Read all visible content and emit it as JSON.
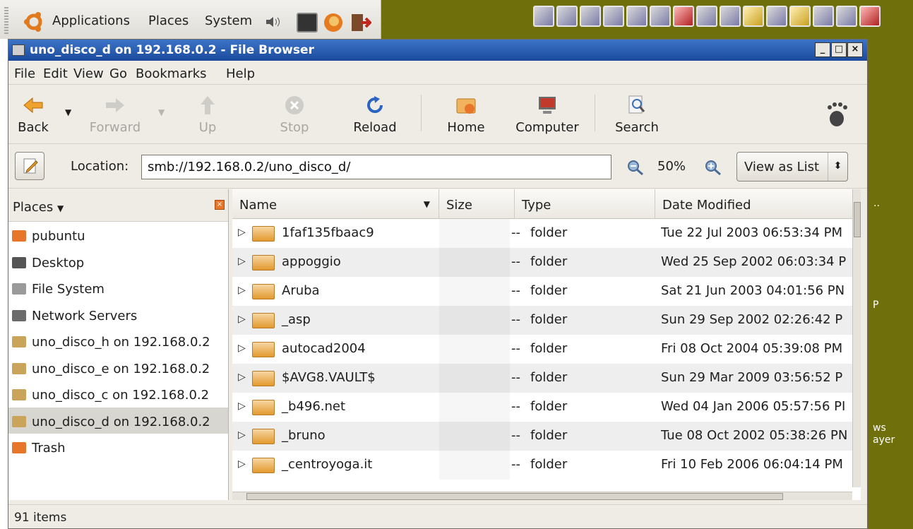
{
  "panel": {
    "menus": [
      "Applications",
      "Places",
      "System"
    ]
  },
  "window": {
    "title": "uno_disco_d on 192.168.0.2 - File Browser",
    "controls": {
      "minimize": "_",
      "maximize": "□",
      "close": "×"
    }
  },
  "menubar": [
    "File",
    "Edit",
    "View",
    "Go",
    "Bookmarks",
    "Help"
  ],
  "toolbar": {
    "back": "Back",
    "forward": "Forward",
    "up": "Up",
    "stop": "Stop",
    "reload": "Reload",
    "home": "Home",
    "computer": "Computer",
    "search": "Search"
  },
  "location": {
    "label": "Location:",
    "value": "smb://192.168.0.2/uno_disco_d/",
    "zoom": "50%",
    "view_mode": "View as List"
  },
  "sidebar": {
    "header": "Places",
    "items": [
      {
        "label": "pubuntu",
        "icon": "home-folder-icon",
        "color": "#e8762a"
      },
      {
        "label": "Desktop",
        "icon": "desktop-icon",
        "color": "#555555"
      },
      {
        "label": "File System",
        "icon": "harddisk-icon",
        "color": "#9a9a9a"
      },
      {
        "label": "Network Servers",
        "icon": "network-icon",
        "color": "#6b6b6b"
      },
      {
        "label": "uno_disco_h on 192.168.0.2",
        "icon": "network-share-icon",
        "color": "#c9a45a"
      },
      {
        "label": "uno_disco_e on 192.168.0.2",
        "icon": "network-share-icon",
        "color": "#c9a45a"
      },
      {
        "label": "uno_disco_c on 192.168.0.2",
        "icon": "network-share-icon",
        "color": "#c9a45a"
      },
      {
        "label": "uno_disco_d on 192.168.0.2",
        "icon": "network-share-icon",
        "color": "#c9a45a",
        "selected": true
      },
      {
        "label": "Trash",
        "icon": "trash-icon",
        "color": "#e8762a"
      }
    ]
  },
  "columns": {
    "name": "Name",
    "size": "Size",
    "type": "Type",
    "date": "Date Modified"
  },
  "files": [
    {
      "name": "1faf135fbaac9",
      "size": "--",
      "type": "folder",
      "date": "Tue 22 Jul 2003 06:53:34 PM"
    },
    {
      "name": "appoggio",
      "size": "--",
      "type": "folder",
      "date": "Wed 25 Sep 2002 06:03:34 P"
    },
    {
      "name": "Aruba",
      "size": "--",
      "type": "folder",
      "date": "Sat 21 Jun 2003 04:01:56 PN"
    },
    {
      "name": "_asp",
      "size": "--",
      "type": "folder",
      "date": "Sun 29 Sep 2002 02:26:42 P"
    },
    {
      "name": "autocad2004",
      "size": "--",
      "type": "folder",
      "date": "Fri 08 Oct 2004 05:39:08 PM"
    },
    {
      "name": "$AVG8.VAULT$",
      "size": "--",
      "type": "folder",
      "date": "Sun 29 Mar 2009 03:56:52 P"
    },
    {
      "name": "_b496.net",
      "size": "--",
      "type": "folder",
      "date": "Wed 04 Jan 2006 05:57:56 PI"
    },
    {
      "name": "_bruno",
      "size": "--",
      "type": "folder",
      "date": "Tue 08 Oct 2002 05:38:26 PN"
    },
    {
      "name": "_centroyoga.it",
      "size": "--",
      "type": "folder",
      "date": "Fri 10 Feb 2006 06:04:14 PM"
    }
  ],
  "status": "91 items",
  "desktop_labels": [
    "..",
    "P",
    "ws",
    "ayer"
  ]
}
